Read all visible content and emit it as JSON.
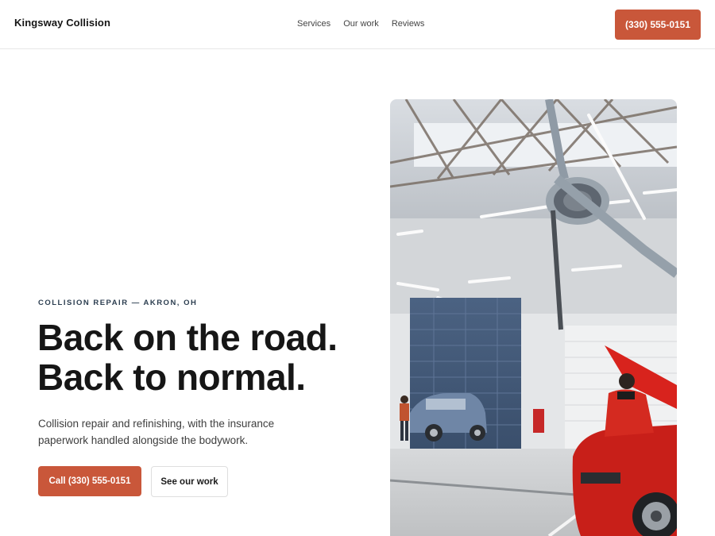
{
  "header": {
    "brand": "Kingsway Collision",
    "nav": [
      "Services",
      "Our work",
      "Reviews"
    ],
    "phone_label": "(330) 555-0151"
  },
  "hero": {
    "eyebrow": "COLLISION REPAIR — AKRON, OH",
    "headline_line1": "Back on the road.",
    "headline_line2": "Back to normal.",
    "subtext": "Collision repair and refinishing, with the insurance paperwork handled alongside the bodywork.",
    "cta_primary": "Call (330) 555-0151",
    "cta_secondary": "See our work"
  },
  "colors": {
    "accent": "#c9573a",
    "heading": "#161616",
    "eyebrow": "#2c3e50"
  }
}
